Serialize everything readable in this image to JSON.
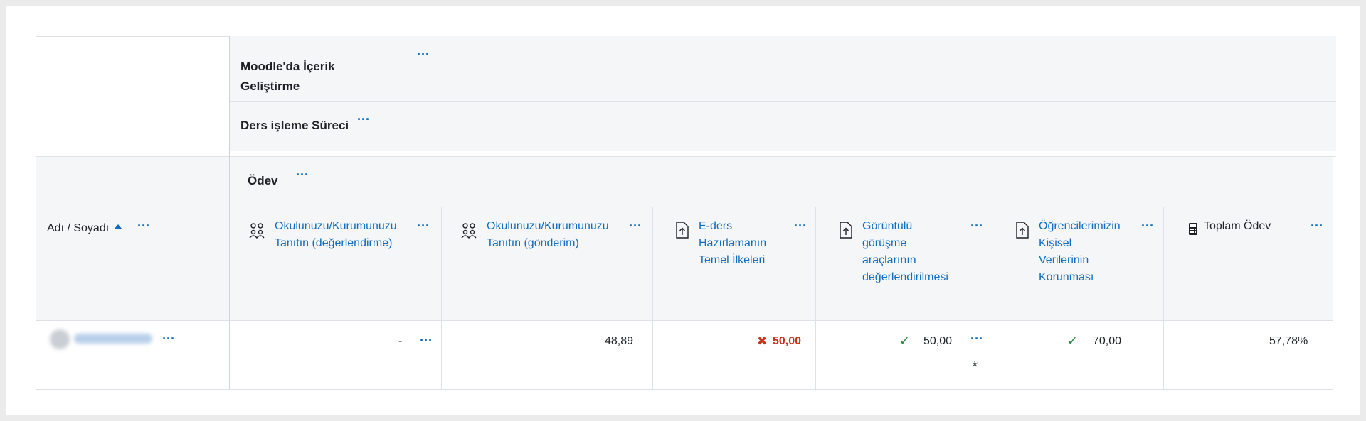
{
  "categories": {
    "top": {
      "label": "Moodle'da İçerik Geliştirme",
      "menu": "···"
    },
    "sub": {
      "label": "Ders işleme Süreci",
      "menu": "···"
    },
    "group": {
      "label": "Ödev",
      "menu": "···"
    }
  },
  "columns": {
    "name": {
      "label": "Adı / Soyadı",
      "sort_icon": "sort-asc-icon",
      "menu": "···"
    },
    "items": [
      {
        "icon": "group-icon",
        "label_lines": [
          "Okulunuzu/Kurumunuzu",
          "Tanıtın (değerlendirme)"
        ],
        "menu": "···"
      },
      {
        "icon": "group-icon",
        "label_lines": [
          "Okulunuzu/Kurumunuzu",
          "Tanıtın (gönderim)"
        ],
        "menu": "···"
      },
      {
        "icon": "assignment-upload-icon",
        "label_lines": [
          "E-ders",
          "Hazırlamanın",
          "Temel İlkeleri"
        ],
        "menu": "···"
      },
      {
        "icon": "assignment-upload-icon",
        "label_lines": [
          "Görüntülü",
          "görüşme",
          "araçlarının",
          "değerlendirilmesi"
        ],
        "menu": "···"
      },
      {
        "icon": "assignment-upload-icon",
        "label_lines": [
          "Öğrencilerimizin",
          "Kişisel",
          "Verilerinin",
          "Korunması"
        ],
        "menu": "···"
      },
      {
        "icon": "calculator-icon",
        "label_lines": [
          "Toplam Ödev"
        ],
        "menu": "···"
      }
    ]
  },
  "row": {
    "user_menu": "···",
    "grades": [
      "-",
      "48,89",
      "50,00",
      "50,00",
      "70,00",
      "57,78%"
    ],
    "grade_menus": [
      "···",
      "",
      "",
      "···",
      "",
      ""
    ],
    "grade2_marker": "✖",
    "grade3_marker": "✓",
    "grade3_asterisk": "*",
    "grade4_marker": "✓"
  },
  "colors": {
    "link": "#0f6cbf",
    "failed": "#ca3120",
    "passed": "#2e8540",
    "header_bg": "#f5f6f8"
  }
}
